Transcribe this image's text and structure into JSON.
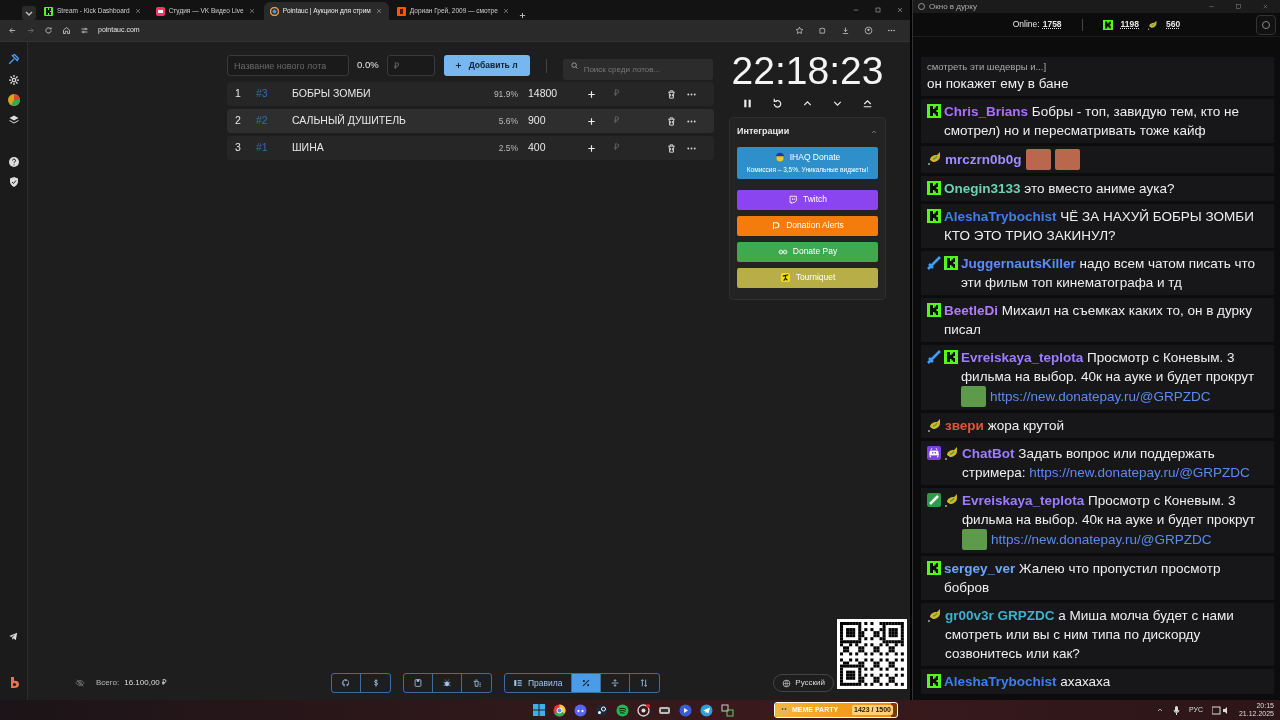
{
  "browser": {
    "tabs": [
      {
        "kind": "kick",
        "title": "Stream - Kick Dashboard",
        "selected": false
      },
      {
        "kind": "vk",
        "title": "Студия — VK Видео Live",
        "selected": false
      },
      {
        "kind": "pointauc",
        "title": "Pointauc | Аукцион для стрим",
        "selected": true
      },
      {
        "kind": "kinopoisk",
        "title": "Дориан Грей, 2009 — смотре",
        "selected": false
      }
    ],
    "url": "pointauc.com"
  },
  "auction": {
    "new_lot": {
      "placeholder": "Название нового лота"
    },
    "percent": "0.0%",
    "amount": {
      "placeholder": "₽"
    },
    "add_button": "Добавить л",
    "search": {
      "placeholder": "Поиск среди лотов..."
    },
    "lots": [
      {
        "number": "1",
        "id": "#3",
        "name": "БОБРЫ ЗОМБИ",
        "share": "91.9%",
        "amount": "14800",
        "currency": "₽"
      },
      {
        "number": "2",
        "id": "#2",
        "name": "САЛЬНЫЙ ДУШИТЕЛЬ",
        "share": "5.6%",
        "amount": "900",
        "currency": "₽"
      },
      {
        "number": "3",
        "id": "#1",
        "name": "ШИНА",
        "share": "2.5%",
        "amount": "400",
        "currency": "₽"
      }
    ]
  },
  "timer": {
    "time": "22:18:23"
  },
  "integrations": {
    "title": "Интеграции",
    "expanded": true,
    "services": [
      {
        "kind": "ihaq",
        "label": "IHAQ Donate",
        "note": "Комиссия – 3,5%. Уникальные виджеты!",
        "color": "#2f8fcb"
      },
      {
        "kind": "twitch",
        "label": "Twitch",
        "color": "#8b45f0"
      },
      {
        "kind": "donationalerts",
        "label": "Donation Alerts",
        "color": "#f47c0c"
      },
      {
        "kind": "donatepay",
        "label": "Donate Pay",
        "color": "#3fa94d"
      },
      {
        "kind": "tourniquet",
        "label": "Tourniquet",
        "color": "#b8ae48"
      }
    ]
  },
  "footer": {
    "total_label": "Всего:",
    "total": "16.100,00 ₽",
    "tool_groups": [
      [
        {
          "kind": "github",
          "selected": false
        },
        {
          "kind": "dollar",
          "selected": false
        }
      ],
      [
        {
          "kind": "save",
          "selected": false
        },
        {
          "kind": "bug",
          "selected": false
        },
        {
          "kind": "clear",
          "selected": false
        }
      ],
      [
        {
          "kind": "rules",
          "label": "Правила",
          "selected": false
        },
        {
          "kind": "percent",
          "selected": true
        },
        {
          "kind": "split",
          "selected": false
        },
        {
          "kind": "sort",
          "selected": false
        }
      ]
    ],
    "language": "Русский"
  },
  "chat": {
    "title": "Окно в дурку",
    "online_label": "Online:",
    "online": "1758",
    "kick_count": "1198",
    "other_count": "560",
    "messages": [
      {
        "reply": "смотреть эти шедевры и...]",
        "parts": [
          {
            "kind": "text",
            "text": "он покажет ему в бане"
          }
        ]
      },
      {
        "badges": [
          {
            "kind": "kick"
          }
        ],
        "user": "Chris_Brians",
        "color": "#a970ff",
        "parts": [
          {
            "kind": "text",
            "text": "Бобры - топ, завидую тем, кто не смотрел) но и пересматривать тоже кайф"
          }
        ]
      },
      {
        "badges": [
          {
            "kind": "bird"
          }
        ],
        "user": "mrczrn0b0g",
        "color": "#a08cff",
        "parts": [
          {
            "kind": "emote"
          },
          {
            "kind": "emote"
          }
        ]
      },
      {
        "badges": [
          {
            "kind": "kick"
          }
        ],
        "user": "Onegin3133",
        "color": "#6fd1b0",
        "parts": [
          {
            "kind": "text",
            "text": "это вместо аниме аука?"
          }
        ]
      },
      {
        "badges": [
          {
            "kind": "kick"
          }
        ],
        "user": "AleshaTrybochist",
        "color": "#3d7ff0",
        "parts": [
          {
            "kind": "text",
            "text": "ЧЁ ЗА НАХУЙ БОБРЫ ЗОМБИ КТО ЭТО ТРИО ЗАКИНУЛ?"
          }
        ]
      },
      {
        "badges": [
          {
            "kind": "sword"
          },
          {
            "kind": "kick"
          }
        ],
        "user": "JuggernautsKiller",
        "color": "#5b8cff",
        "parts": [
          {
            "kind": "text",
            "text": "надо всем чатом писать что эти фильм топ кинематографа и тд"
          }
        ]
      },
      {
        "badges": [
          {
            "kind": "kick"
          }
        ],
        "user": "BeetleDi",
        "color": "#b07cff",
        "parts": [
          {
            "kind": "text",
            "text": "Михаил на съемках каких то, он в дурку писал"
          }
        ]
      },
      {
        "badges": [
          {
            "kind": "sword"
          },
          {
            "kind": "kick"
          }
        ],
        "user": "Evreiskaya_teplota",
        "color": "#9d7dff",
        "parts": [
          {
            "kind": "text",
            "text": "Просмотр с Коневым. 3 фильма на выбор. 40к на ауке и будет прокрут"
          },
          {
            "kind": "emote"
          },
          {
            "kind": "link",
            "text": "https://new.donatepay.ru/@GRPZDC"
          }
        ]
      },
      {
        "badges": [
          {
            "kind": "bird"
          }
        ],
        "user": "звери",
        "color": "#e5533d",
        "parts": [
          {
            "kind": "text",
            "text": "жора крутой"
          }
        ]
      },
      {
        "badges": [
          {
            "kind": "bot"
          },
          {
            "kind": "bird"
          }
        ],
        "user": "ChatBot",
        "color": "#9d7dff",
        "parts": [
          {
            "kind": "text",
            "text": "Задать вопрос или поддержать стримера:"
          },
          {
            "kind": "link",
            "text": "https://new.donatepay.ru/@GRPZDC"
          }
        ]
      },
      {
        "badges": [
          {
            "kind": "pen"
          },
          {
            "kind": "bird"
          }
        ],
        "user": "Evreiskaya_teplota",
        "color": "#9d7dff",
        "parts": [
          {
            "kind": "text",
            "text": "Просмотр с Коневым. 3 фильма на выбор. 40к на ауке и будет прокрут"
          },
          {
            "kind": "emote"
          },
          {
            "kind": "link",
            "text": "https://new.donatepay.ru/@GRPZDC"
          }
        ]
      },
      {
        "badges": [
          {
            "kind": "kick"
          }
        ],
        "user": "sergey_ver",
        "color": "#6aa8ff",
        "parts": [
          {
            "kind": "text",
            "text": "Жалею что пропустил просмотр бобров"
          }
        ]
      },
      {
        "badges": [
          {
            "kind": "bird"
          }
        ],
        "user": "gr00v3r",
        "color": "#3fb0d0",
        "parts": [
          {
            "kind": "mention",
            "text": "GRPZDC"
          },
          {
            "kind": "text",
            "text": "а Миша молча будет с нами смотреть или вы с ним типа по дискорду созвонитесь или как?"
          }
        ]
      },
      {
        "badges": [
          {
            "kind": "kick"
          }
        ],
        "user": "AleshaTrybochist",
        "color": "#3d7ff0",
        "parts": [
          {
            "kind": "text",
            "text": "ахахаха"
          }
        ]
      }
    ]
  },
  "taskbar": {
    "widget": {
      "title": "MEME PARTY",
      "progress": "1423 / 1500",
      "level": 0.95
    },
    "language": "РУС",
    "time": "20:15",
    "date": "21.12.2025"
  }
}
